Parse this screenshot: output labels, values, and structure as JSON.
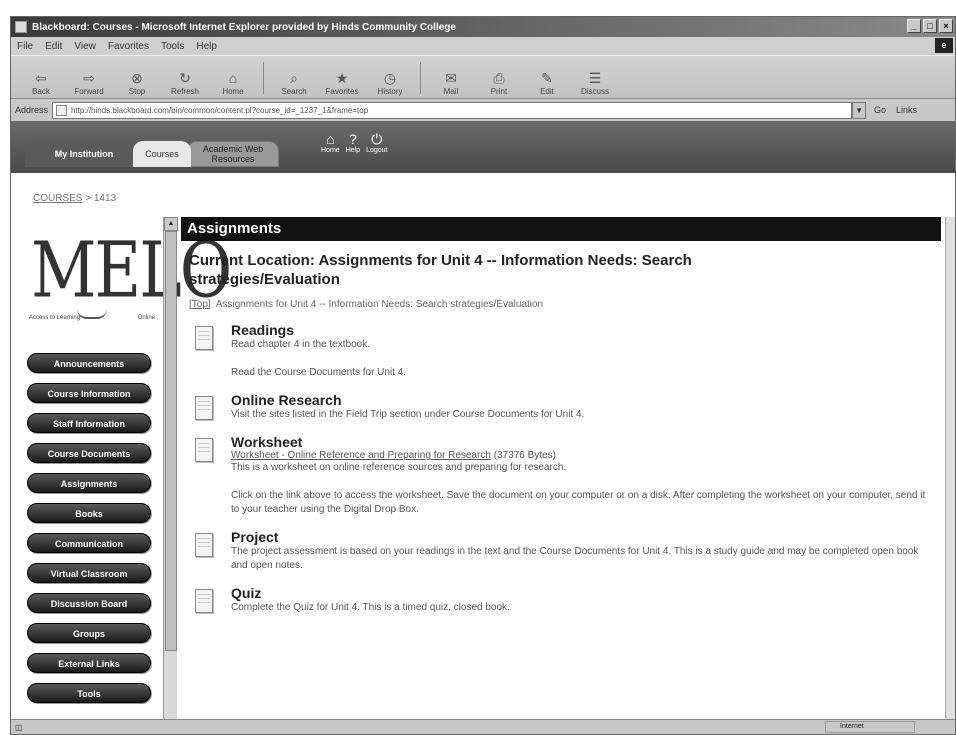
{
  "window": {
    "title": "Blackboard: Courses - Microsoft Internet Explorer provided by Hinds Community College",
    "controls": [
      "_",
      "□",
      "×"
    ]
  },
  "menu": [
    "File",
    "Edit",
    "View",
    "Favorites",
    "Tools",
    "Help"
  ],
  "toolbar": {
    "buttons": [
      {
        "label": "Back",
        "icon": "⇦"
      },
      {
        "label": "Forward",
        "icon": "⇨"
      },
      {
        "label": "Stop",
        "icon": "⊗"
      },
      {
        "label": "Refresh",
        "icon": "↻"
      },
      {
        "label": "Home",
        "icon": "⌂"
      },
      {
        "label": "Search",
        "icon": "⌕"
      },
      {
        "label": "Favorites",
        "icon": "★"
      },
      {
        "label": "History",
        "icon": "◷"
      },
      {
        "label": "Mail",
        "icon": "✉"
      },
      {
        "label": "Print",
        "icon": "⎙"
      },
      {
        "label": "Edit",
        "icon": "✎"
      },
      {
        "label": "Discuss",
        "icon": "☰"
      }
    ]
  },
  "address": {
    "label": "Address",
    "url": "http://hinds.blackboard.com/bin/common/content.pl?course_id=_1237_1&frame=top",
    "go": "Go",
    "links": "Links"
  },
  "bb_nav": {
    "tab_institution": "My Institution",
    "tab_courses": "Courses",
    "tab_academic": "Academic Web Resources",
    "icons": [
      {
        "label": "Home",
        "icon": "⌂"
      },
      {
        "label": "Help",
        "icon": "?"
      },
      {
        "label": "Logout",
        "icon": "⏻"
      }
    ]
  },
  "breadcrumb": {
    "root": "COURSES",
    "sep": " > ",
    "current": "1413"
  },
  "logo": {
    "text": "MELO",
    "left": "Access to Learning",
    "right": "Online"
  },
  "sidebar": [
    "Announcements",
    "Course Information",
    "Staff Information",
    "Course Documents",
    "Assignments",
    "Books",
    "Communication",
    "Virtual Classroom",
    "Discussion Board",
    "Groups",
    "External Links",
    "Tools"
  ],
  "main": {
    "header": "Assignments",
    "current_location": "Current Location: Assignments for Unit 4 -- Information Needs: Search strategies/Evaluation",
    "top_link": "Top",
    "top_path": "Assignments for Unit 4 -- Information Needs: Search strategies/Evaluation",
    "items": [
      {
        "title": "Readings",
        "desc1": "Read chapter 4 in the textbook.",
        "desc2": "Read the Course Documents for Unit 4."
      },
      {
        "title": "Online Research",
        "desc1": "Visit the sites listed in the Field Trip section under Course Documents for Unit 4."
      },
      {
        "title": "Worksheet",
        "link": "Worksheet - Online Reference and Preparing for Research",
        "link_size": "(37376 Bytes)",
        "desc1": "This is a worksheet on online reference sources and preparing for research.",
        "desc2": "Click on the link above to access the worksheet. Save the document on your computer or on a disk. After completing the worksheet on your computer, send it to your teacher using the Digital Drop Box."
      },
      {
        "title": "Project",
        "desc1": "The project assessment is based on your readings in the text and the Course Documents for Unit 4. This is a study guide and may be completed open book and open notes."
      },
      {
        "title": "Quiz",
        "desc1": "Complete the Quiz for Unit 4. This is a timed quiz, closed book."
      }
    ]
  },
  "status": {
    "zone": "Internet"
  }
}
